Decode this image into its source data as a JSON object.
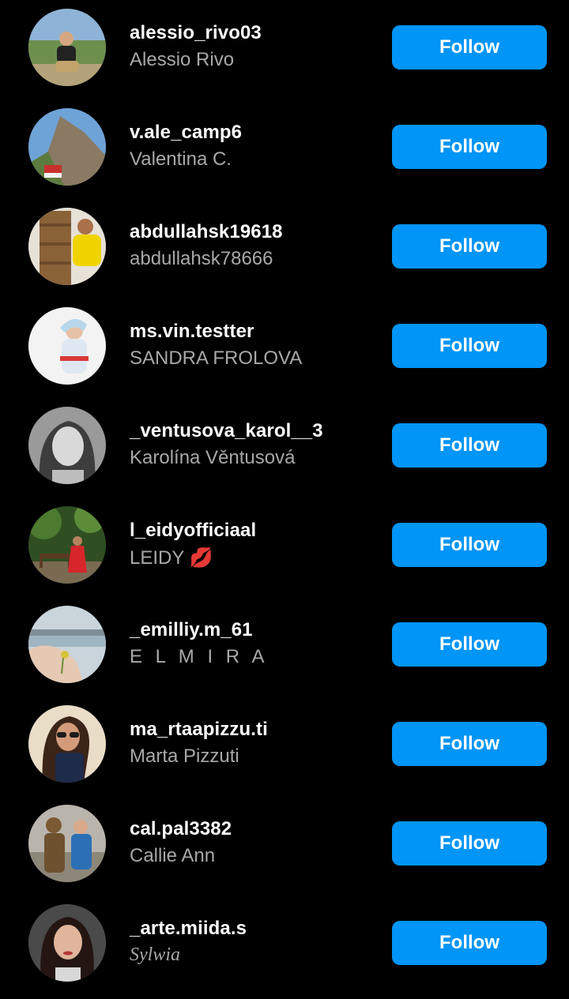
{
  "accent_color": "#0095f6",
  "suggestions": [
    {
      "username": "alessio_rivo03",
      "full_name": "Alessio Rivo",
      "button_label": "Follow",
      "avatar": "avatar-photo-hiker"
    },
    {
      "username": "v.ale_camp6",
      "full_name": "Valentina C.",
      "button_label": "Follow",
      "avatar": "avatar-photo-mountain"
    },
    {
      "username": "abdullahsk19618",
      "full_name": "abdullahsk78666",
      "button_label": "Follow",
      "avatar": "avatar-photo-yellow-shirt"
    },
    {
      "username": "ms.vin.testter",
      "full_name": "SANDRA FROLOVA",
      "button_label": "Follow",
      "avatar": "avatar-photo-woman-white"
    },
    {
      "username": "_ventusova_karol__3",
      "full_name": "Karolína Věntusová",
      "button_label": "Follow",
      "avatar": "avatar-photo-bw-portrait"
    },
    {
      "username": "l_eidyofficiaal",
      "full_name": "LEIDY 💋",
      "button_label": "Follow",
      "avatar": "avatar-photo-garden"
    },
    {
      "username": "_emilliy.m_61",
      "full_name": "E L M I R A",
      "button_label": "Follow",
      "avatar": "avatar-photo-lake"
    },
    {
      "username": "ma_rtaapizzu.ti",
      "full_name": "Marta Pizzuti",
      "button_label": "Follow",
      "avatar": "avatar-photo-sunglasses"
    },
    {
      "username": "cal.pal3382",
      "full_name": "Callie Ann",
      "button_label": "Follow",
      "avatar": "avatar-photo-statue"
    },
    {
      "username": "_arte.miida.s",
      "full_name": "Sylwia",
      "button_label": "Follow",
      "avatar": "avatar-photo-selfie"
    }
  ]
}
